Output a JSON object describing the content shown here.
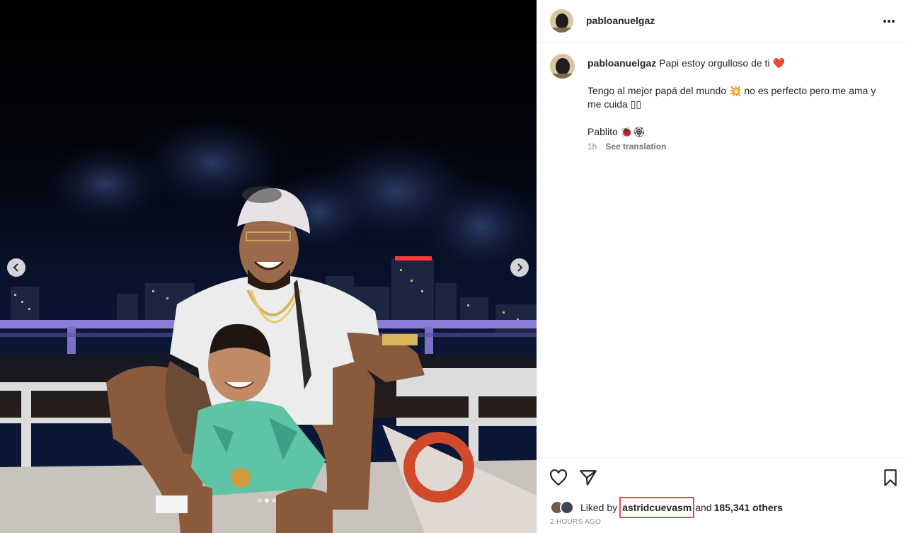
{
  "post": {
    "username": "pabloanuelgaz",
    "caption": {
      "username": "pabloanuelgaz",
      "line1": "Papi estoy orgulloso de ti",
      "line1_emoji": "❤️",
      "para2_a": "Tengo al mejor papá del mundo",
      "para2_emoji": "💥",
      "para2_b": "no es perfecto pero me ama y me cuida",
      "para2_end": "▯▯",
      "para3_text": "Pablito",
      "para3_emoji": "🐞🏵"
    },
    "time": "1h",
    "see_translation": "See translation",
    "likes": {
      "prefix": "Liked by",
      "user": "astridcuevasm",
      "middle": "and",
      "count": "185,341 others"
    },
    "posted_ago": "2 HOURS AGO"
  },
  "carousel": {
    "slide_count": 3,
    "active_slide": 2
  },
  "icons": {
    "like": "heart-icon",
    "share": "paper-plane-icon",
    "save": "bookmark-icon",
    "more": "more-options-icon",
    "prev": "chevron-left-icon",
    "next": "chevron-right-icon"
  },
  "colors": {
    "text": "#262626",
    "secondary_text": "#8e8e8e",
    "highlight_box": "#d9534f",
    "heart": "#ed4956"
  }
}
